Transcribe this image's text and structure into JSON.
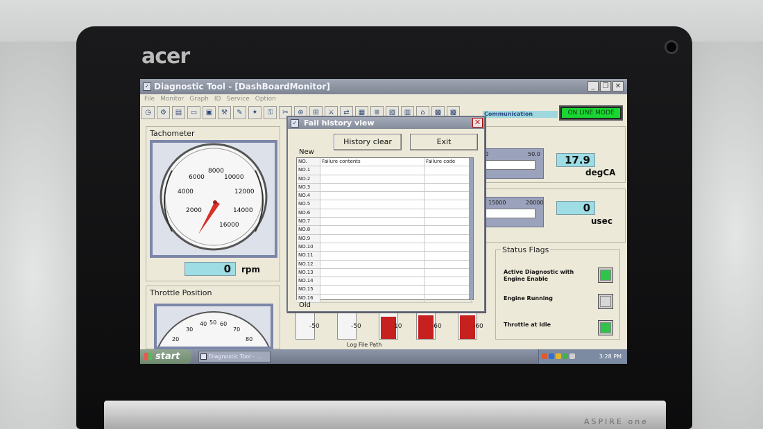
{
  "device": {
    "brand": "acer",
    "model": "ASPIRE one"
  },
  "window": {
    "title": "Diagnostic Tool - [DashBoardMonitor]",
    "buttons": {
      "minimize": "_",
      "maximize": "❐",
      "close": "✕"
    }
  },
  "menu": [
    "File",
    "Monitor",
    "Graph",
    "ID",
    "Service",
    "Option"
  ],
  "toolbar": {
    "communication_label": "Communication",
    "online_mode": "ON LINE MODE"
  },
  "tachometer": {
    "title": "Tachometer",
    "ticks": [
      "2000",
      "4000",
      "6000",
      "8000",
      "10000",
      "12000",
      "14000",
      "16000"
    ],
    "value": "0",
    "unit": "rpm"
  },
  "throttle": {
    "title": "Throttle Position",
    "ticks": [
      "20",
      "30",
      "40",
      "50",
      "60",
      "70",
      "80"
    ]
  },
  "gauge_ca": {
    "scale_max": "50.0",
    "value": "17.9",
    "unit": "degCA"
  },
  "gauge_us": {
    "scale_mid": "15000",
    "scale_max": "20000",
    "value": "0",
    "unit": "usec"
  },
  "status_flags": {
    "title": "Status Flags",
    "items": [
      {
        "label": "Active Diagnostic with Engine Enable",
        "state": "on",
        "color": "#2fc34a"
      },
      {
        "label": "Engine Running",
        "state": "off",
        "color": "#d7d7d7"
      },
      {
        "label": "Throttle at Idle",
        "state": "on",
        "color": "#2fc34a"
      }
    ]
  },
  "bars": [
    {
      "label": "-50",
      "fill": 0
    },
    {
      "label": "-50",
      "fill": 0
    },
    {
      "label": "10",
      "fill": 0.85
    },
    {
      "label": "-60",
      "fill": 0.9
    },
    {
      "label": "-60",
      "fill": 0.9
    }
  ],
  "log_file_path_label": "Log File Path",
  "dialog": {
    "title": "Fail history view",
    "history_clear": "History clear",
    "exit": "Exit",
    "new_label": "New",
    "old_label": "Old",
    "columns": [
      "NO.",
      "Failure contents",
      "Failure code"
    ],
    "rows": [
      "NO.1",
      "NO.2",
      "NO.3",
      "NO.4",
      "NO.5",
      "NO.6",
      "NO.7",
      "NO.8",
      "NO.9",
      "NO.10",
      "NO.11",
      "NO.12",
      "NO.13",
      "NO.14",
      "NO.15",
      "NO.16"
    ]
  },
  "taskbar": {
    "start": "start",
    "task_item": "Diagnostic Tool - ...",
    "clock": "3:28 PM"
  }
}
